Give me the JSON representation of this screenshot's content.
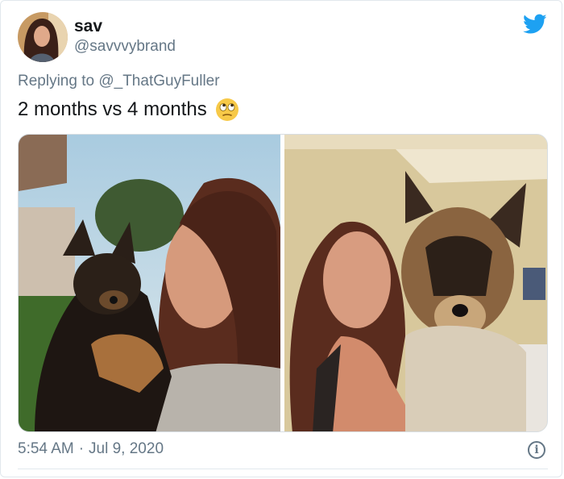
{
  "author": {
    "display_name": "sav",
    "handle": "@savvvybrand"
  },
  "reply_context": {
    "prefix": "Replying to",
    "target": "@_ThatGuyFuller"
  },
  "tweet": {
    "text": "2 months vs 4 months",
    "emoji": "eye-roll-emoji"
  },
  "media": {
    "photos": [
      {
        "description_icon": "puppy-photo-icon"
      },
      {
        "description_icon": "dog-photo-icon"
      }
    ]
  },
  "meta": {
    "time": "5:54 AM",
    "separator": "·",
    "date": "Jul 9, 2020"
  },
  "icons": {
    "brand": "twitter-bird-icon",
    "info": "info-icon"
  },
  "colors": {
    "brand": "#1da1f2",
    "secondary_text": "#657786",
    "primary_text": "#14171a"
  }
}
